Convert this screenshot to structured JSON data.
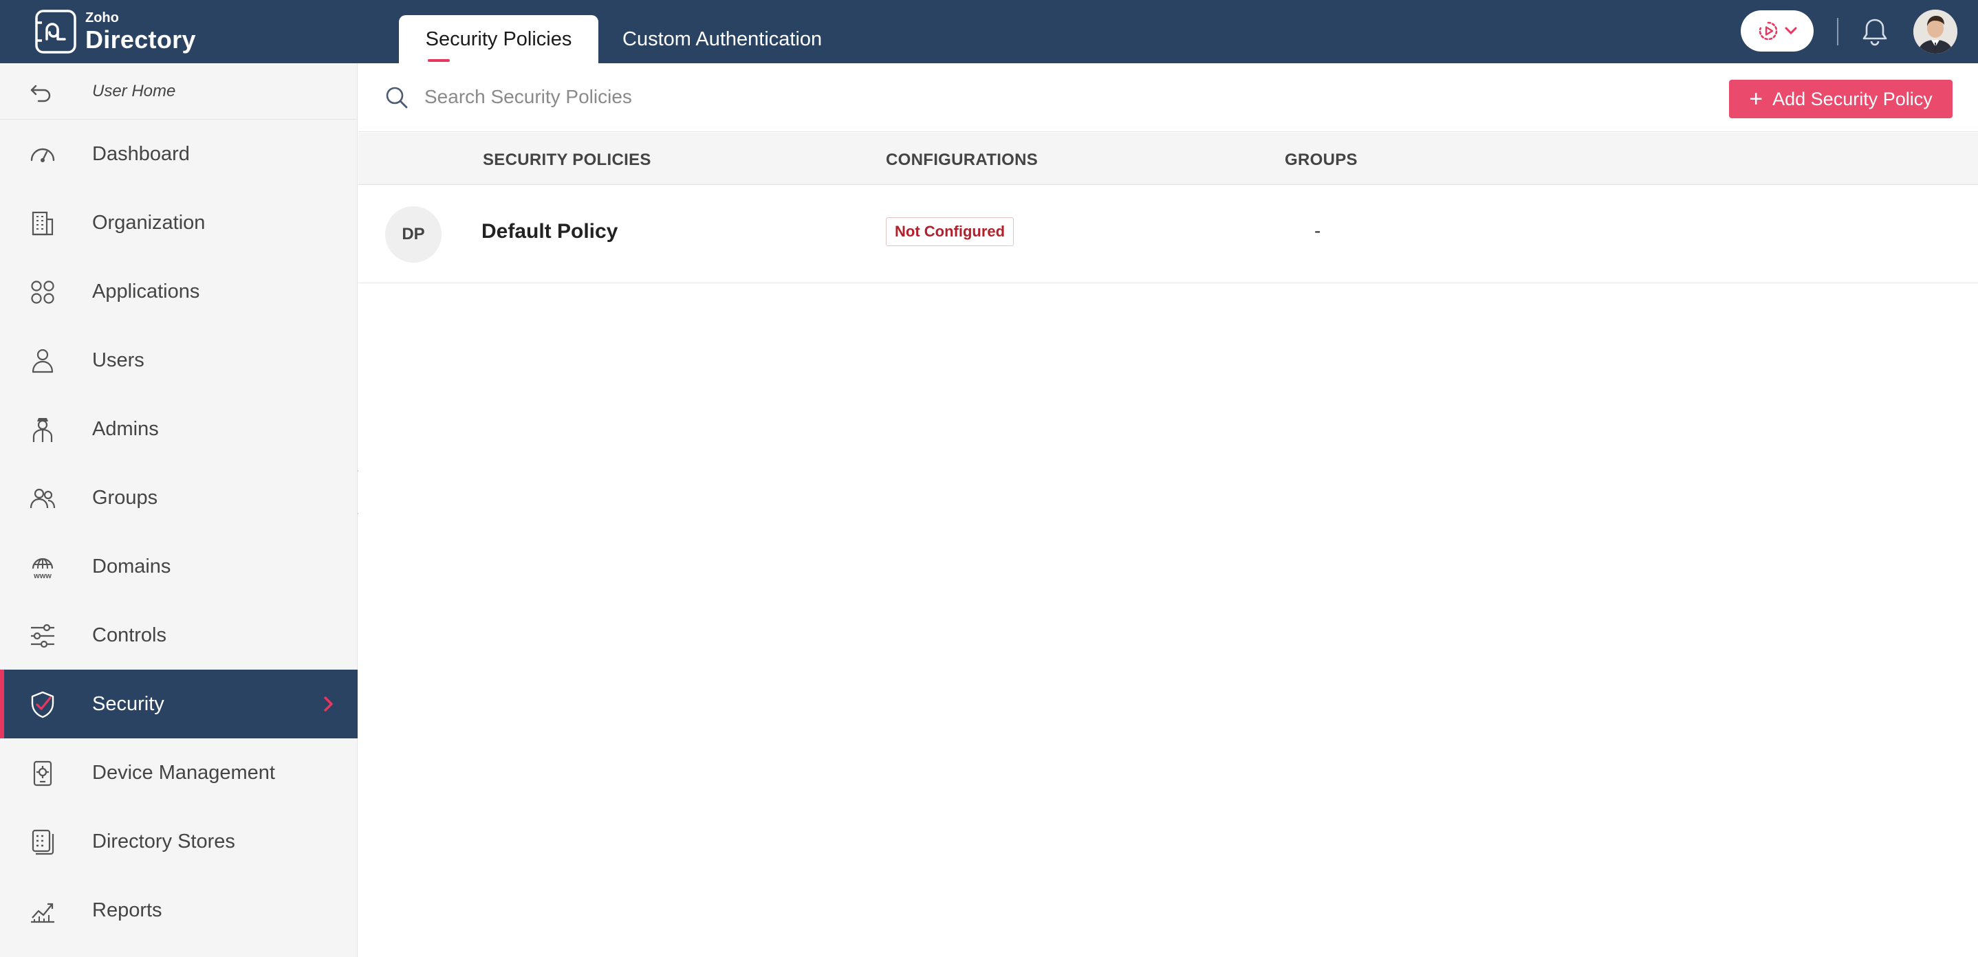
{
  "brand": {
    "small": "Zoho",
    "big": "Directory"
  },
  "tabs": [
    {
      "label": "Security Policies",
      "active": true
    },
    {
      "label": "Custom Authentication",
      "active": false
    }
  ],
  "header": {
    "launch_icon": "play-circle-icon",
    "notifications_icon": "bell-icon"
  },
  "sidebar": {
    "back_label": "User Home",
    "items": [
      {
        "label": "Dashboard",
        "icon": "gauge-icon"
      },
      {
        "label": "Organization",
        "icon": "building-icon"
      },
      {
        "label": "Applications",
        "icon": "apps-grid-icon"
      },
      {
        "label": "Users",
        "icon": "user-icon"
      },
      {
        "label": "Admins",
        "icon": "admin-icon"
      },
      {
        "label": "Groups",
        "icon": "group-icon"
      },
      {
        "label": "Domains",
        "icon": "globe-www-icon"
      },
      {
        "label": "Controls",
        "icon": "sliders-icon"
      },
      {
        "label": "Security",
        "icon": "shield-check-icon",
        "active": true
      },
      {
        "label": "Device Management",
        "icon": "device-gear-icon"
      },
      {
        "label": "Directory Stores",
        "icon": "store-icon"
      },
      {
        "label": "Reports",
        "icon": "chart-trend-icon"
      }
    ]
  },
  "search": {
    "placeholder": "Search Security Policies",
    "value": ""
  },
  "add_button": {
    "label": "Add Security Policy"
  },
  "table": {
    "columns": [
      "SECURITY POLICIES",
      "CONFIGURATIONS",
      "GROUPS"
    ],
    "rows": [
      {
        "initials": "DP",
        "name": "Default Policy",
        "configuration": "Not Configured",
        "groups": "-"
      }
    ]
  },
  "colors": {
    "header_bg": "#2b4363",
    "accent": "#e7365f",
    "button": "#ea4a6c",
    "sidebar_bg": "#f5f5f5"
  }
}
